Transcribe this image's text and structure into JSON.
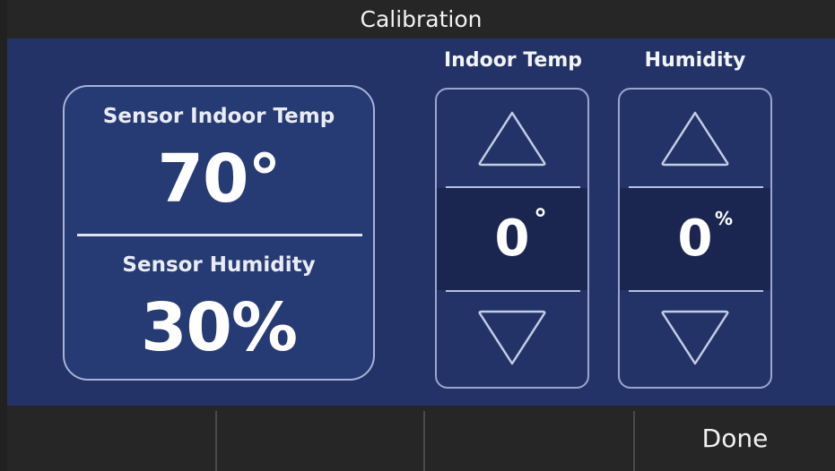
{
  "title": "Calibration",
  "sensor": {
    "indoor_temp_label": "Sensor Indoor Temp",
    "indoor_temp_value": "70°",
    "humidity_label": "Sensor Humidity",
    "humidity_value": "30%"
  },
  "steppers": [
    {
      "header": "Indoor Temp",
      "value": "0",
      "unit": "°"
    },
    {
      "header": "Humidity",
      "value": "0",
      "unit": "%"
    }
  ],
  "softkeys": [
    "",
    "",
    "",
    "Done"
  ],
  "colors": {
    "panel": "#233367",
    "title_bar": "#262626",
    "outline": "#a7b2d6"
  }
}
